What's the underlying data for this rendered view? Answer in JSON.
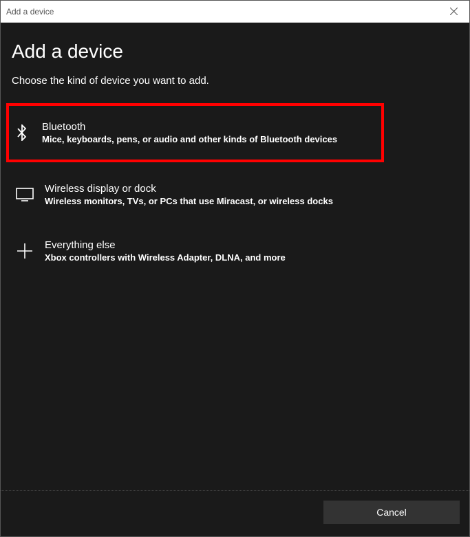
{
  "titlebar": {
    "title": "Add a device"
  },
  "main": {
    "heading": "Add a device",
    "subheading": "Choose the kind of device you want to add."
  },
  "options": {
    "bluetooth": {
      "title": "Bluetooth",
      "description": "Mice, keyboards, pens, or audio and other kinds of Bluetooth devices"
    },
    "wireless": {
      "title": "Wireless display or dock",
      "description": "Wireless monitors, TVs, or PCs that use Miracast, or wireless docks"
    },
    "everything": {
      "title": "Everything else",
      "description": "Xbox controllers with Wireless Adapter, DLNA, and more"
    }
  },
  "footer": {
    "cancel_label": "Cancel"
  }
}
